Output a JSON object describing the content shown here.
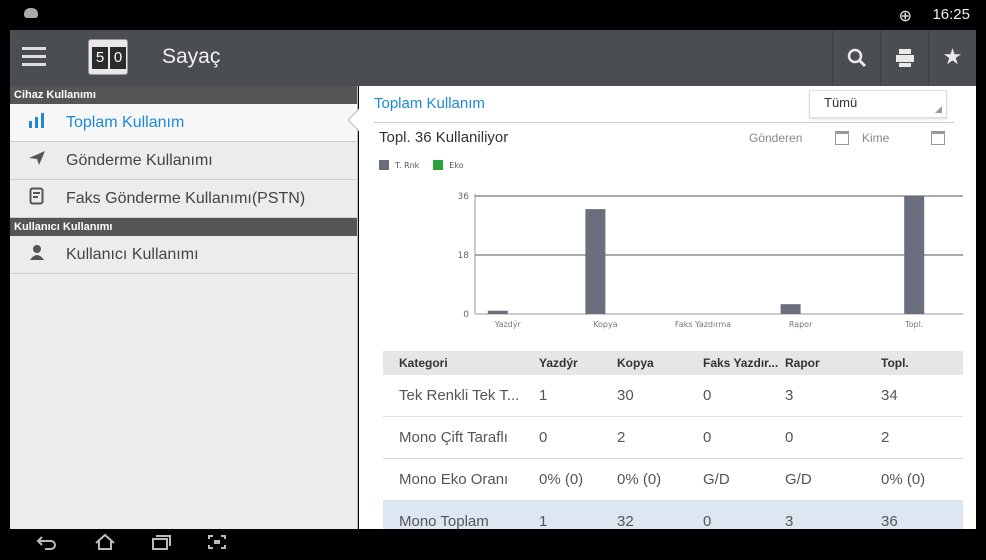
{
  "status_bar": {
    "time": "16:25",
    "globe_icon": "globe-icon"
  },
  "app_bar": {
    "logo_digits": [
      "5",
      "0"
    ],
    "title": "Sayaç",
    "icons": [
      "menu-icon",
      "search-icon",
      "printer-icon",
      "star-icon"
    ]
  },
  "sidebar": {
    "section1": "Cihaz Kullanımı",
    "items": [
      {
        "label": "Toplam Kullanım",
        "icon": "bar-chart-icon",
        "active": true
      },
      {
        "label": "Gönderme Kullanımı",
        "icon": "send-icon",
        "active": false
      },
      {
        "label": "Faks Gönderme Kullanımı(PSTN)",
        "icon": "fax-document-icon",
        "active": false
      }
    ],
    "section2": "Kullanıcı Kullanımı",
    "user_item": {
      "label": "Kullanıcı Kullanımı",
      "icon": "user-icon"
    }
  },
  "main": {
    "header": "Toplam Kullanım",
    "filter": {
      "selected": "Tümü"
    },
    "usage_summary": "Topl. 36 Kullaniliyor",
    "from_label": "Gönderen",
    "to_label": "Kime",
    "legend": [
      {
        "label": "T. Rnk",
        "color": "#6b6e7c"
      },
      {
        "label": "Eko",
        "color": "#2aa33a"
      }
    ]
  },
  "chart_data": {
    "type": "bar",
    "categories": [
      "Yazdýr",
      "Kopya",
      "Faks Yazdırma",
      "Rapor",
      "Topl."
    ],
    "series": [
      {
        "name": "T. Rnk",
        "values": [
          1,
          32,
          0,
          3,
          36
        ]
      },
      {
        "name": "Eko",
        "values": [
          0,
          0,
          0,
          0,
          0
        ]
      }
    ],
    "yticks": [
      0,
      18,
      36
    ],
    "ylim": [
      0,
      36
    ]
  },
  "table": {
    "headers": [
      "Kategori",
      "Yazdýr",
      "Kopya",
      "Faks Yazdır...",
      "Rapor",
      "Topl."
    ],
    "rows": [
      [
        "Tek Renkli Tek T...",
        "1",
        "30",
        "0",
        "3",
        "34"
      ],
      [
        "Mono Çift Taraflı",
        "0",
        "2",
        "0",
        "0",
        "2"
      ],
      [
        "Mono Eko Oranı",
        "0% (0)",
        "0% (0)",
        "G/D",
        "G/D",
        "0% (0)"
      ],
      [
        "Mono Toplam",
        "1",
        "32",
        "0",
        "3",
        "36"
      ]
    ]
  },
  "nav_bar": {
    "icons": [
      "back-icon",
      "home-icon",
      "recents-icon",
      "screenshot-icon"
    ]
  }
}
